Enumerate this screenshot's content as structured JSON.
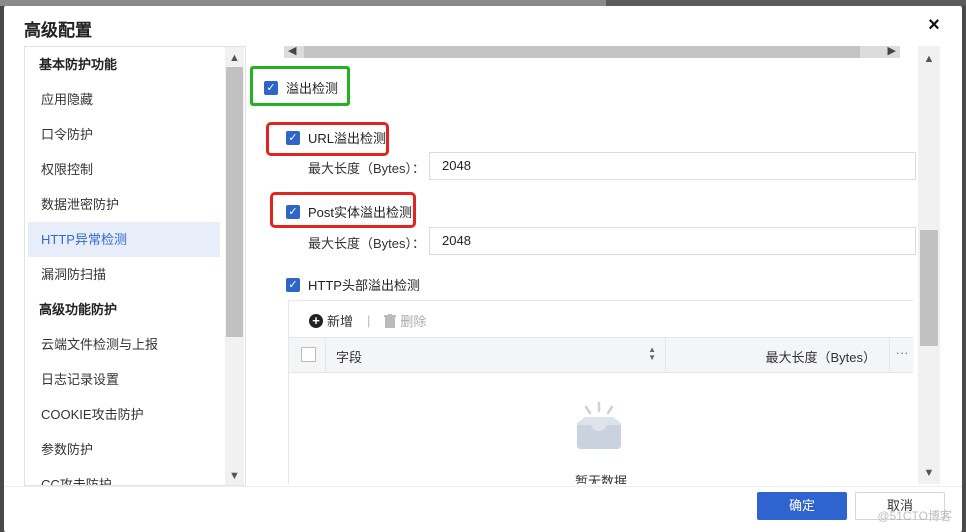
{
  "dialog": {
    "title": "高级配置",
    "close_icon": "×"
  },
  "sidebar": {
    "items": [
      {
        "label": "基本防护功能",
        "type": "group"
      },
      {
        "label": "应用隐藏",
        "type": "item"
      },
      {
        "label": "口令防护",
        "type": "item"
      },
      {
        "label": "权限控制",
        "type": "item"
      },
      {
        "label": "数据泄密防护",
        "type": "item"
      },
      {
        "label": "HTTP异常检测",
        "type": "item",
        "active": true
      },
      {
        "label": "漏洞防扫描",
        "type": "item"
      },
      {
        "label": "高级功能防护",
        "type": "group"
      },
      {
        "label": "云端文件检测与上报",
        "type": "item"
      },
      {
        "label": "日志记录设置",
        "type": "item"
      },
      {
        "label": "COOKIE攻击防护",
        "type": "item"
      },
      {
        "label": "参数防护",
        "type": "item"
      },
      {
        "label": "CC攻击防护",
        "type": "item"
      }
    ]
  },
  "main": {
    "overflow_check": {
      "label": "溢出检测",
      "checked": true
    },
    "url_check": {
      "label": "URL溢出检测",
      "checked": true,
      "max_label": "最大长度（Bytes）：",
      "max_value": "2048"
    },
    "post_check": {
      "label": "Post实体溢出检测",
      "checked": true,
      "max_label": "最大长度（Bytes）：",
      "max_value": "2048"
    },
    "header_check": {
      "label": "HTTP头部溢出检测",
      "checked": true
    },
    "table": {
      "add_label": "新增",
      "separator": "|",
      "delete_label": "删除",
      "col_field": "字段",
      "col_maxlen": "最大长度（Bytes）",
      "col_more": "···",
      "empty_text": "暂无数据"
    }
  },
  "footer": {
    "ok_label": "确定",
    "cancel_label": "取消"
  },
  "watermark": "@51CTO博客",
  "colors": {
    "primary": "#2f64d0",
    "highlight_green": "#22b322",
    "highlight_red": "#e3231f",
    "active_bg": "#e8eef9"
  }
}
